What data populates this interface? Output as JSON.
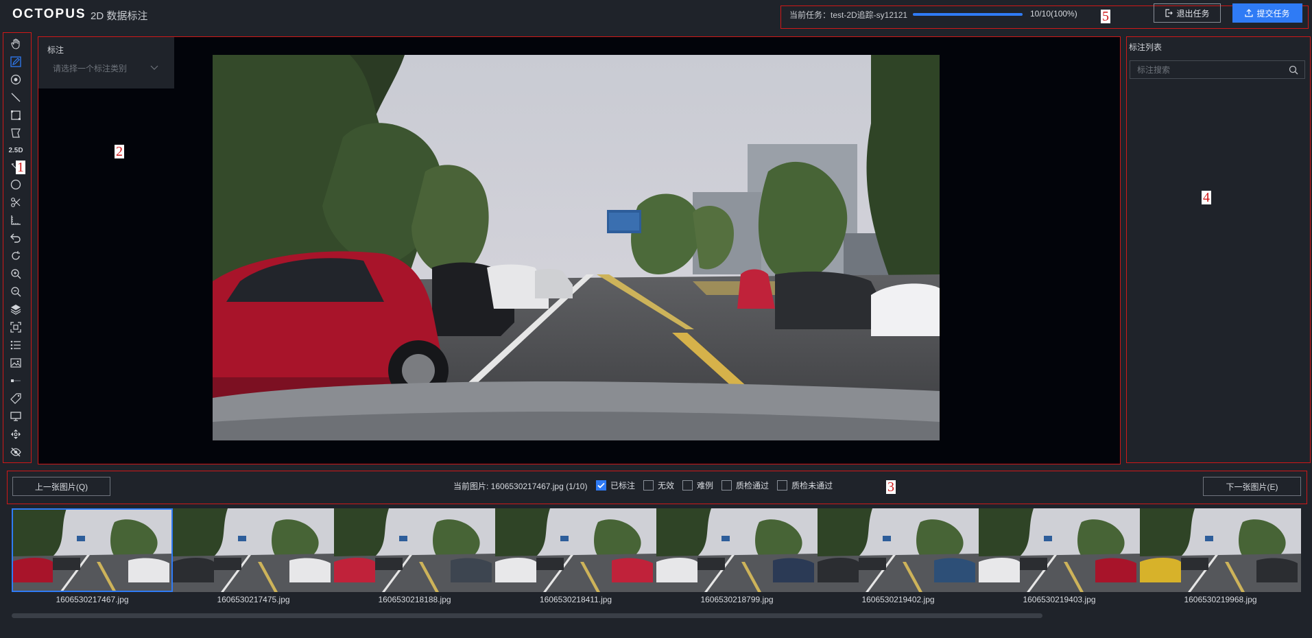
{
  "header": {
    "logo": "OCTOPUS",
    "subtitle": "2D 数据标注",
    "task_label": "当前任务：test-2D追踪-sy12121",
    "progress_fraction": 1.0,
    "progress_text": "10/10(100%)",
    "exit_label": "退出任务",
    "submit_label": "提交任务"
  },
  "regions": [
    "1",
    "2",
    "3",
    "4",
    "5"
  ],
  "toolbar": {
    "tools": [
      "hand-icon",
      "pencil-icon",
      "point-icon",
      "line-icon",
      "rectangle-icon",
      "polygon-icon",
      "2-5d-label",
      "cuboid-line-icon",
      "circle-icon",
      "scissors-icon",
      "ruler-icon",
      "undo-icon",
      "rotate-icon",
      "zoom-in-icon",
      "zoom-out-icon",
      "layers-icon",
      "fit-screen-icon",
      "list-icon",
      "image-icon",
      "brightness-icon",
      "tag-icon",
      "monitor-icon",
      "move-icon",
      "eye-off-icon"
    ],
    "label_25d": "2.5D"
  },
  "annotation": {
    "title": "标注",
    "select_placeholder": "请选择一个标注类别"
  },
  "right_panel": {
    "title": "标注列表",
    "search_placeholder": "标注搜索"
  },
  "bottom_bar": {
    "prev_label": "上一张图片(Q)",
    "next_label": "下一张图片(E)",
    "current_image": "当前图片: 1606530217467.jpg (1/10)",
    "checks": [
      {
        "label": "已标注",
        "checked": true
      },
      {
        "label": "无效",
        "checked": false
      },
      {
        "label": "难例",
        "checked": false
      },
      {
        "label": "质检通过",
        "checked": false
      },
      {
        "label": "质检未通过",
        "checked": false
      }
    ]
  },
  "thumbnails": [
    {
      "name": "1606530217467.jpg",
      "selected": true
    },
    {
      "name": "1606530217475.jpg",
      "selected": false
    },
    {
      "name": "1606530218188.jpg",
      "selected": false
    },
    {
      "name": "1606530218411.jpg",
      "selected": false
    },
    {
      "name": "1606530218799.jpg",
      "selected": false
    },
    {
      "name": "1606530219402.jpg",
      "selected": false
    },
    {
      "name": "1606530219403.jpg",
      "selected": false
    },
    {
      "name": "1606530219968.jpg",
      "selected": false
    }
  ],
  "colors": {
    "accent": "#2f7bf5",
    "region_border": "#d01818",
    "background": "#1f232a",
    "canvas": "#02040a"
  }
}
